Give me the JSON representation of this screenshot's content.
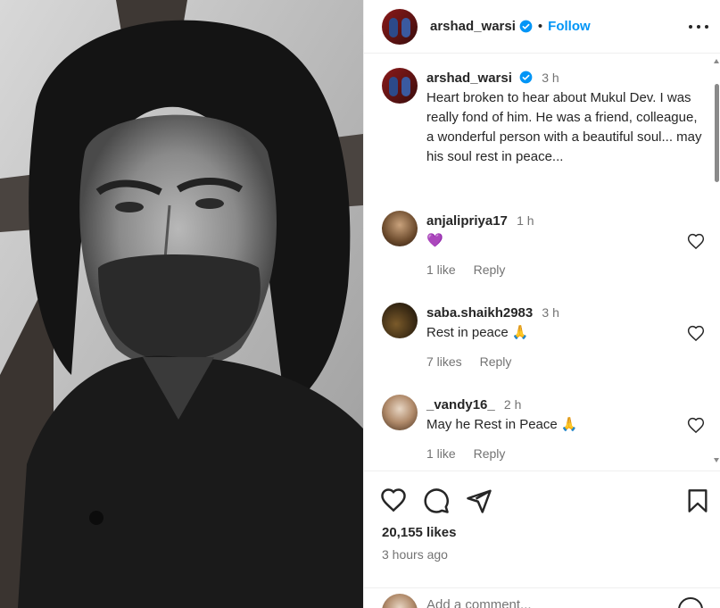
{
  "post": {
    "author": "arshad_warsi",
    "follow_label": "Follow",
    "separator": "•"
  },
  "caption": {
    "author": "arshad_warsi",
    "time": "3 h",
    "text": "Heart broken to hear about Mukul Dev. I was really fond of him. He was a friend, colleague, a wonderful person with a beautiful soul... may his soul rest in peace..."
  },
  "comments": [
    {
      "user": "anjalipriya17",
      "time": "1 h",
      "text": "💜",
      "likes": "1 like",
      "reply_label": "Reply"
    },
    {
      "user": "saba.shaikh2983",
      "time": "3 h",
      "text": "Rest in peace 🙏",
      "likes": "7 likes",
      "reply_label": "Reply"
    },
    {
      "user": "_vandy16_",
      "time": "2 h",
      "text": "May he Rest in Peace 🙏",
      "likes": "1 like",
      "reply_label": "Reply"
    }
  ],
  "stats": {
    "likes": "20,155 likes",
    "posted": "3 hours ago"
  },
  "add_comment": {
    "placeholder": "Add a comment..."
  },
  "colors": {
    "accent": "#0095f6",
    "verified": "#0095f6",
    "text": "#262626",
    "muted": "#737373"
  }
}
